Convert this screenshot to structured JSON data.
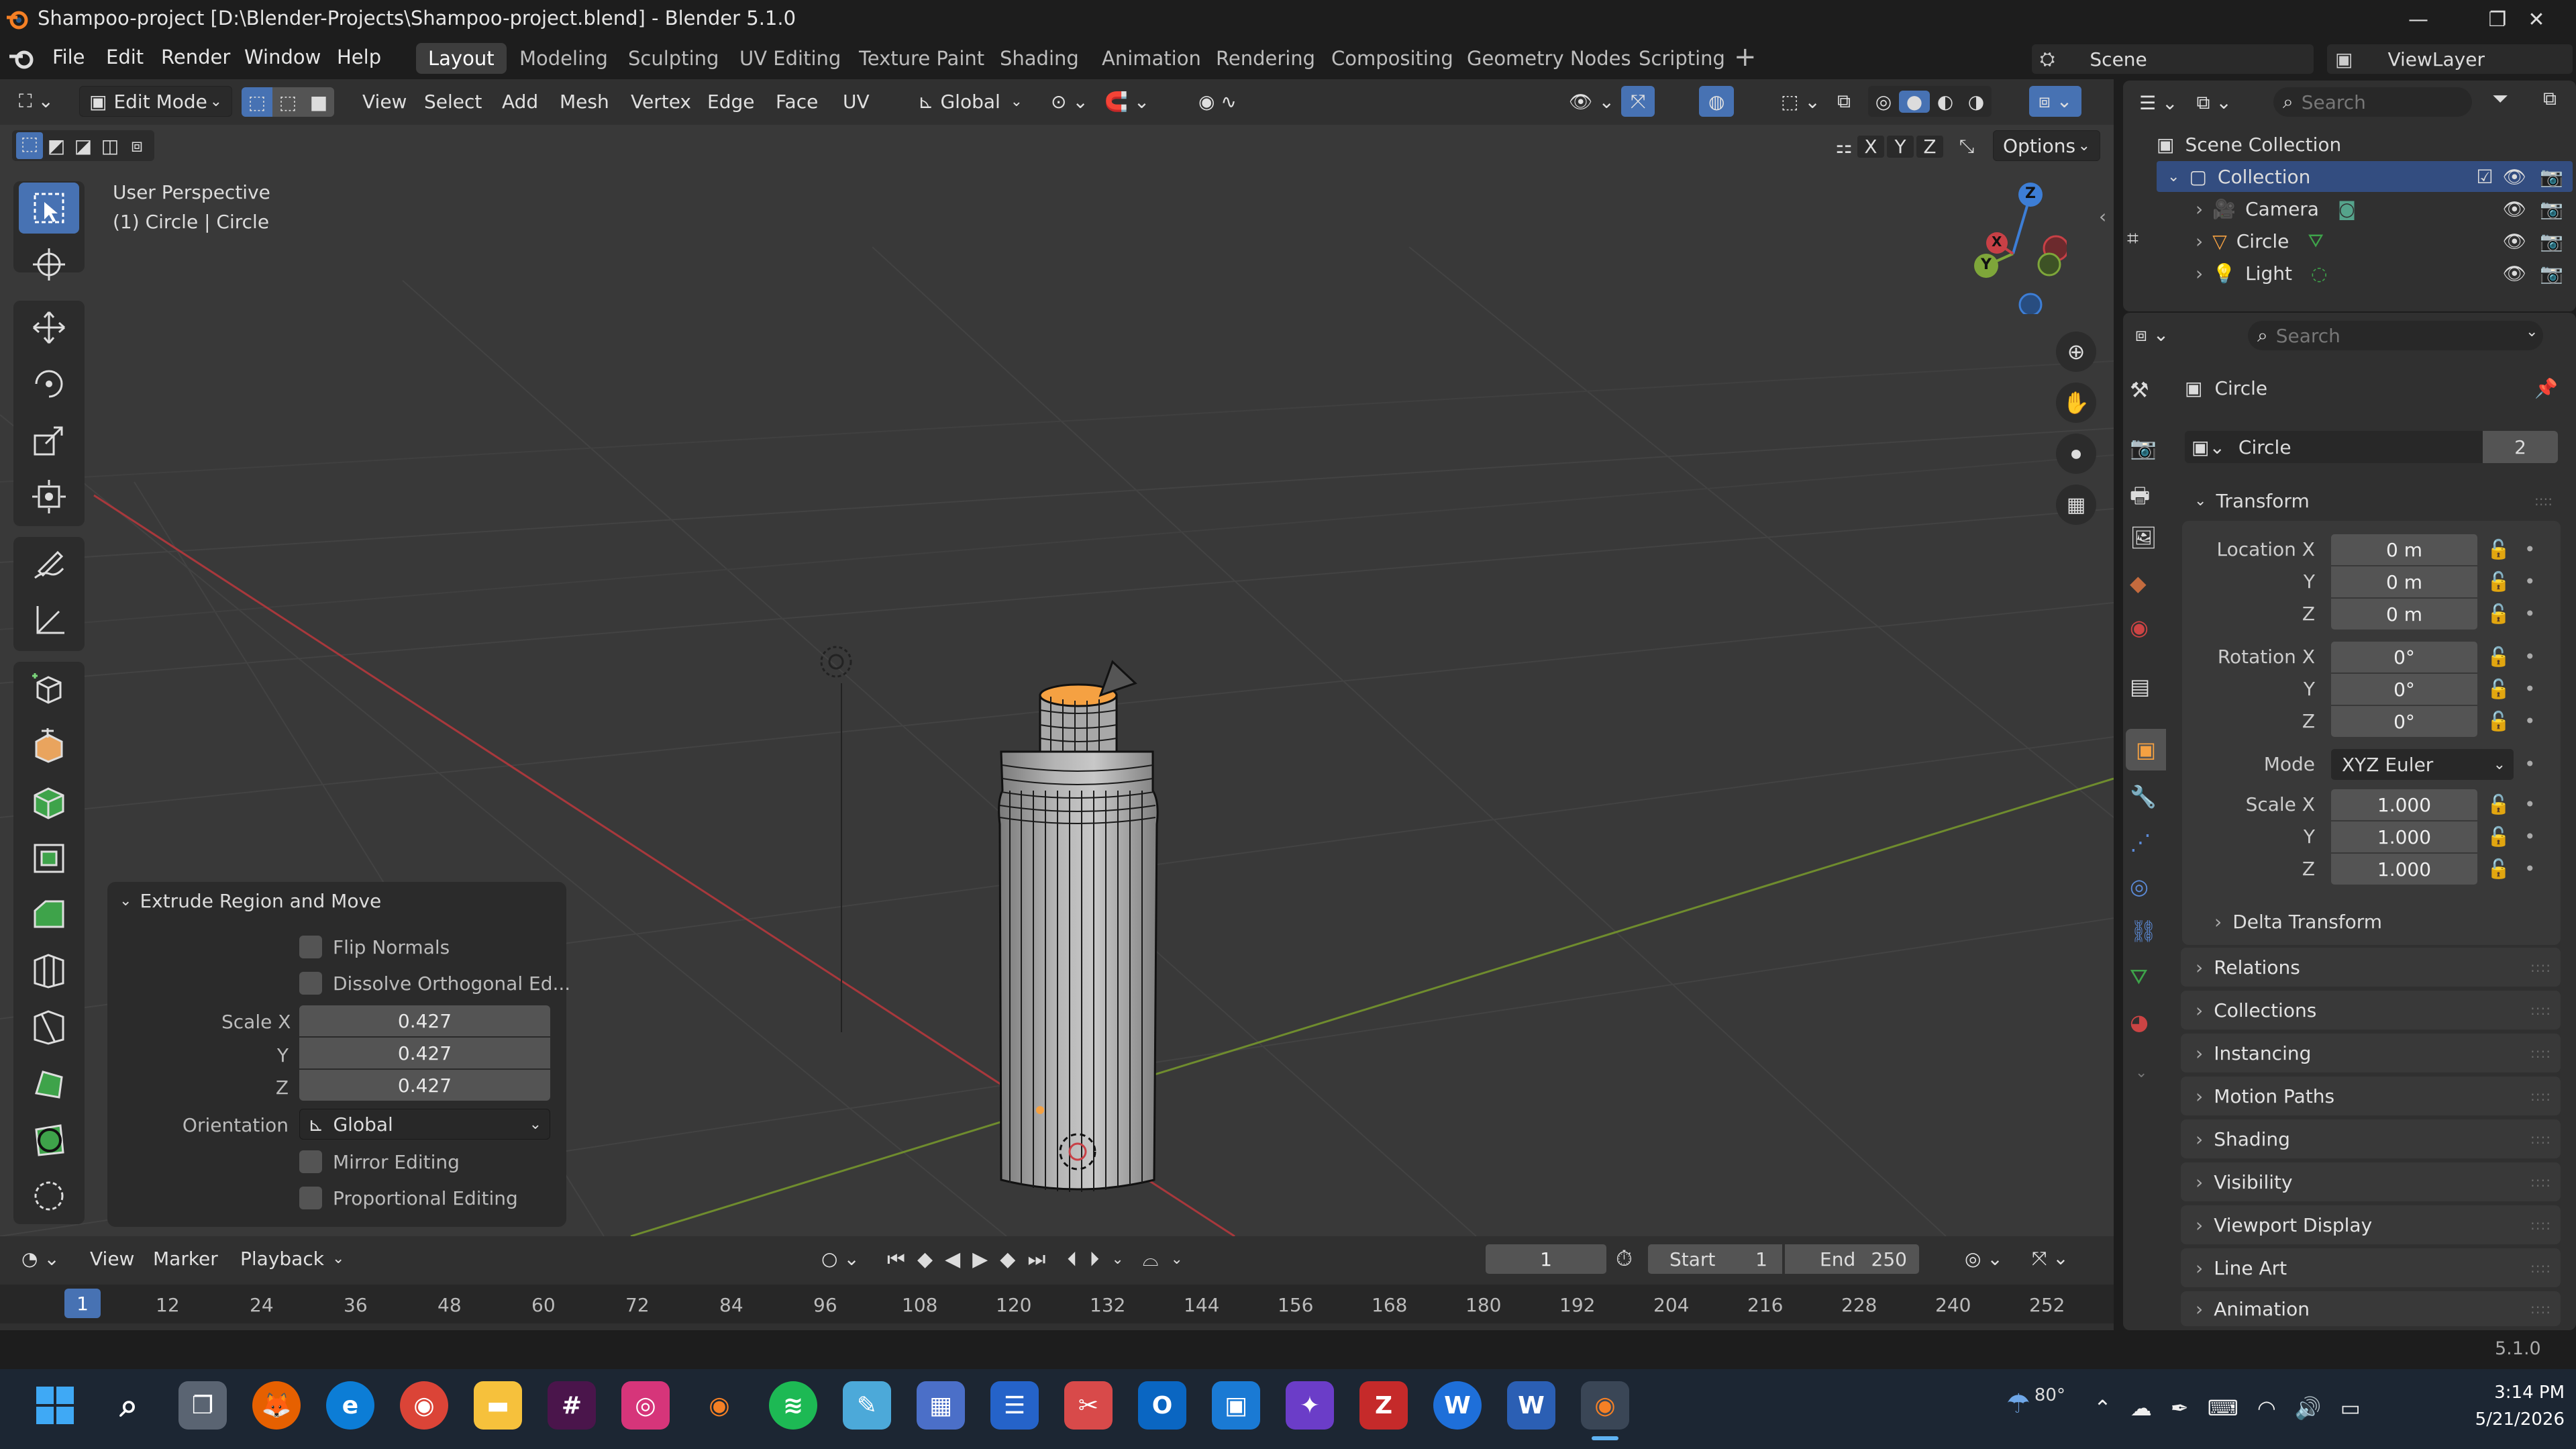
{
  "window": {
    "title": "Shampoo-project [D:\\Blender-Projects\\Shampoo-project.blend] - Blender 5.1.0"
  },
  "menu": [
    "File",
    "Edit",
    "Render",
    "Window",
    "Help"
  ],
  "workspaces": [
    "Layout",
    "Modeling",
    "Sculpting",
    "UV Editing",
    "Texture Paint",
    "Shading",
    "Animation",
    "Rendering",
    "Compositing",
    "Geometry Nodes",
    "Scripting"
  ],
  "active_workspace": "Layout",
  "scene": {
    "name": "Scene",
    "viewlayer": "ViewLayer"
  },
  "viewport_header": {
    "mode": "Edit Mode",
    "menus": [
      "View",
      "Select",
      "Add",
      "Mesh",
      "Vertex",
      "Edge",
      "Face",
      "UV"
    ],
    "transform_orientation": "Global",
    "axes": [
      "X",
      "Y",
      "Z"
    ],
    "options": "Options"
  },
  "viewport": {
    "perspective": "User Perspective",
    "object_info": "(1) Circle | Circle",
    "gizmo_axes": [
      "Z",
      "Y",
      "X"
    ]
  },
  "operator_panel": {
    "title": "Extrude Region and Move",
    "flip_normals": "Flip Normals",
    "dissolve": "Dissolve Orthogonal Ed...",
    "scale_label": "Scale X",
    "y_label": "Y",
    "z_label": "Z",
    "scale_x": "0.427",
    "scale_y": "0.427",
    "scale_z": "0.427",
    "orientation_label": "Orientation",
    "orientation_value": "Global",
    "mirror": "Mirror Editing",
    "proportional": "Proportional Editing"
  },
  "outliner": {
    "search_placeholder": "Search",
    "scene_collection": "Scene Collection",
    "collection": "Collection",
    "items": [
      "Camera",
      "Circle",
      "Light"
    ]
  },
  "properties": {
    "search_placeholder": "Search",
    "object_name": "Circle",
    "data_name": "Circle",
    "users": "2",
    "transform": "Transform",
    "location_label": "Location X",
    "rotation_label": "Rotation X",
    "scale_label": "Scale X",
    "y_label": "Y",
    "z_label": "Z",
    "location": [
      "0 m",
      "0 m",
      "0 m"
    ],
    "rotation": [
      "0°",
      "0°",
      "0°"
    ],
    "mode_label": "Mode",
    "mode_value": "XYZ Euler",
    "scale": [
      "1.000",
      "1.000",
      "1.000"
    ],
    "delta": "Delta Transform",
    "sections": [
      "Relations",
      "Collections",
      "Instancing",
      "Motion Paths",
      "Shading",
      "Visibility",
      "Viewport Display",
      "Line Art",
      "Animation"
    ]
  },
  "timeline": {
    "menus": [
      "View",
      "Marker",
      "Playback"
    ],
    "current_frame": "1",
    "start_label": "Start",
    "start": "1",
    "end_label": "End",
    "end": "250",
    "ticks": [
      "1",
      "12",
      "24",
      "36",
      "48",
      "60",
      "72",
      "84",
      "96",
      "108",
      "120",
      "132",
      "144",
      "156",
      "168",
      "180",
      "192",
      "204",
      "216",
      "228",
      "240",
      "252"
    ]
  },
  "status": {
    "version": "5.1.0"
  },
  "taskbar": {
    "weather": "80°",
    "time": "3:14 PM",
    "date": "5/21/2026"
  },
  "colors": {
    "accent": "#4772b3",
    "selection": "#f5a142",
    "x_axis": "#c84046",
    "y_axis": "#7ea63a",
    "z_axis": "#3d7ed6"
  }
}
